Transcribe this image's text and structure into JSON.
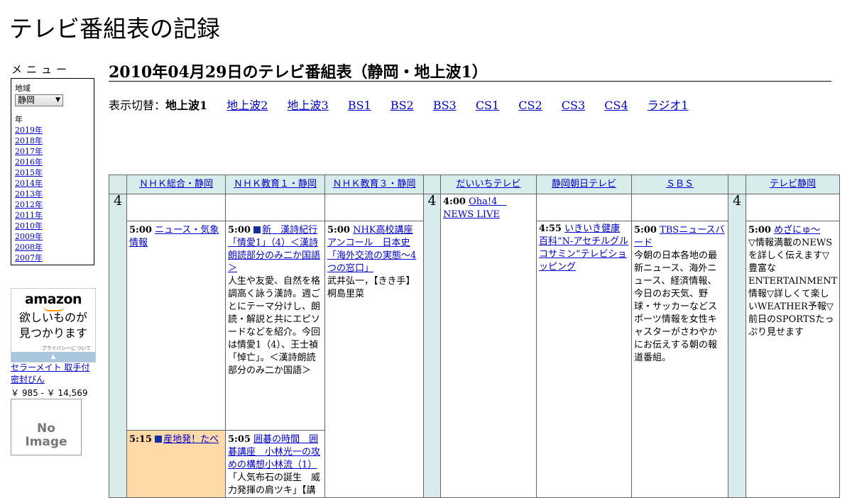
{
  "site_title": "テレビ番組表の記録",
  "menu": {
    "title": "メニュー",
    "region_label": "地域",
    "region_value": "静岡",
    "year_label": "年",
    "years": [
      "2019年",
      "2018年",
      "2017年",
      "2016年",
      "2015年",
      "2014年",
      "2013年",
      "2012年",
      "2011年",
      "2010年",
      "2009年",
      "2008年",
      "2007年"
    ]
  },
  "ad": {
    "brand": "amazon",
    "tagline_1": "欲しいものが",
    "tagline_2": "見つかります",
    "privacy": "プライバシーについて",
    "product_1": "セラーメイト 取手付",
    "product_2": "密封びん",
    "price": "￥ 985 - ￥ 14,569",
    "noimage_1": "No",
    "noimage_2": "Image"
  },
  "page_heading": "2010年04月29日のテレビ番組表（静岡・地上波1）",
  "switch": {
    "label": "表示切替：",
    "current": "地上波1",
    "links": [
      "地上波2",
      "地上波3",
      "BS1",
      "BS2",
      "BS3",
      "CS1",
      "CS2",
      "CS3",
      "CS4",
      "ラジオ1"
    ]
  },
  "channels": [
    "ＮＨＫ総合・静岡",
    "ＮＨＫ教育１・静岡",
    "ＮＨＫ教育３・静岡",
    "だいいちテレビ",
    "静岡朝日テレビ",
    "ＳＢＳ",
    "テレビ静岡"
  ],
  "hour": "4",
  "programs": {
    "nhk1_a": {
      "time": "5:00",
      "title": "ニュース・気象情報"
    },
    "nhk1_b": {
      "time": "5:15",
      "title": "産地発！たべ"
    },
    "etv1_a": {
      "time": "5:00",
      "title": "新　漢詩紀行「情愛1」（4）＜漢詩朗読部分のみ二か国語＞",
      "desc": "人生や友愛、自然を格調高く詠う漢詩。週ごとにテーマ分けし、朗読・解説と共にエピソードなどを紹介。今回は情愛1（4）、王士禎「悼亡」。＜漢詩朗読部分のみ二か国語＞"
    },
    "etv1_b": {
      "time": "5:05",
      "title": "囲碁の時間　囲碁講座　小林光一の攻めの構想小林流（1）",
      "desc": "「人気布石の誕生　威力発揮の肩ツキ」【講"
    },
    "etv3_a": {
      "time": "5:00",
      "title": "NHK高校講座アンコール　日本史「海外交流の実態～4つの窓口」",
      "desc": "武井弘一，【きき手】桐島里菜"
    },
    "daiichi_a": {
      "time": "4:00",
      "title": "Oha!4　NEWS LIVE"
    },
    "asahi_a": {
      "time": "4:55",
      "title": "いきいき健康百科“N-アセチルグルコサミン”テレビショッピング"
    },
    "sbs_a": {
      "time": "5:00",
      "title": "TBSニュースバード",
      "desc": "今朝の日本各地の最新ニュース、海外ニュース、経済情報、今日のお天気、野球・サッカーなどスポーツ情報を女性キャスターがさわやかにお伝えする朝の報道番組。"
    },
    "tvs_a": {
      "time": "5:00",
      "title": "めざにゅ～",
      "desc": "▽情報満載のNEWSを詳しく伝えます▽豊富なENTERTAINMENT情報▽詳しくて楽しいWEATHER予報▽前日のSPORTSたっぷり見せます"
    }
  }
}
